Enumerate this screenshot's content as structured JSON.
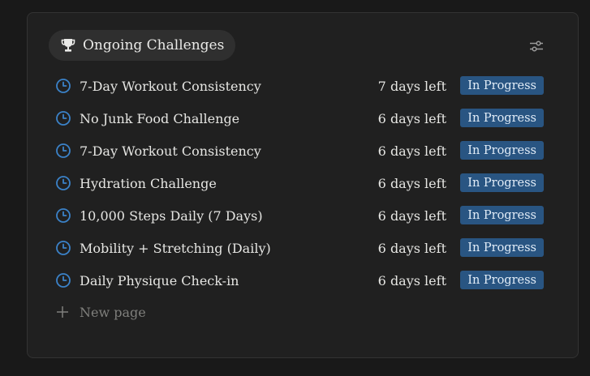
{
  "header": {
    "title": "Ongoing Challenges",
    "icon": "trophy-icon",
    "settings_icon": "sliders-icon"
  },
  "rows": [
    {
      "title": "7-Day Workout Consistency",
      "days": "7 days left",
      "status": "In Progress"
    },
    {
      "title": "No Junk Food Challenge",
      "days": "6 days left",
      "status": "In Progress"
    },
    {
      "title": "7-Day Workout Consistency",
      "days": "6 days left",
      "status": "In Progress"
    },
    {
      "title": "Hydration Challenge",
      "days": "6 days left",
      "status": "In Progress"
    },
    {
      "title": "10,000 Steps Daily (7 Days)",
      "days": "6 days left",
      "status": "In Progress"
    },
    {
      "title": "Mobility + Stretching (Daily)",
      "days": "6 days left",
      "status": "In Progress"
    },
    {
      "title": "Daily Physique Check-in",
      "days": "6 days left",
      "status": "In Progress"
    }
  ],
  "new_page": {
    "label": "New page",
    "icon": "plus-icon"
  },
  "colors": {
    "background": "#191919",
    "card": "#202020",
    "pill": "#2f2f2f",
    "status_badge": "#295582",
    "clock_icon": "#3b82c8"
  }
}
